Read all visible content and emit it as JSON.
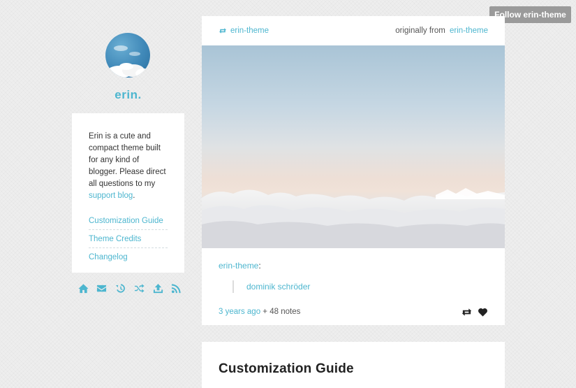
{
  "follow_button": {
    "label": "Follow erin-theme"
  },
  "sidebar": {
    "title": "erin.",
    "about": {
      "text": "Erin is a cute and compact theme built for any kind of blogger. Please direct all questions to my ",
      "link_label": "support blog",
      "end": "."
    },
    "links": [
      {
        "label": "Customization Guide"
      },
      {
        "label": "Theme Credits"
      },
      {
        "label": "Changelog"
      }
    ],
    "icons": [
      "home-icon",
      "mail-icon",
      "archive-icon",
      "shuffle-icon",
      "upload-icon",
      "rss-icon"
    ]
  },
  "post": {
    "reblogged_from": "erin-theme",
    "originally_from_label": "originally from",
    "originally_from": "erin-theme",
    "caption_user": "erin-theme",
    "caption_colon": ":",
    "quote": "dominik schröder",
    "time": "3 years ago",
    "notes": " + 48 notes"
  },
  "second_post": {
    "title": "Customization Guide"
  },
  "colors": {
    "accent": "#4db6cf",
    "follow_bg": "#9a9a9a",
    "background": "#eeeeee"
  }
}
